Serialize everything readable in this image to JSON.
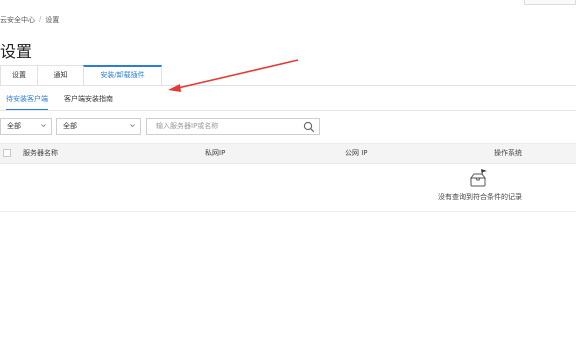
{
  "breadcrumb": {
    "root": "云安全中心",
    "separator": "/",
    "current": "设置"
  },
  "page": {
    "title": "设置"
  },
  "tabs": [
    {
      "label": "设置"
    },
    {
      "label": "通知"
    },
    {
      "label": "安装/卸载插件"
    }
  ],
  "subtabs": [
    {
      "label": "待安装客户端"
    },
    {
      "label": "客户端安装指南"
    }
  ],
  "filters": {
    "select1": "全部",
    "select2": "全部",
    "search_placeholder": "输入服务器IP或名称"
  },
  "table": {
    "columns": [
      "服务器名称",
      "私网IP",
      "公网 IP",
      "操作系统"
    ],
    "empty_text": "没有查询到符合条件的记录"
  },
  "colors": {
    "accent": "#2b7ddc",
    "annotation_arrow": "#e53935"
  }
}
